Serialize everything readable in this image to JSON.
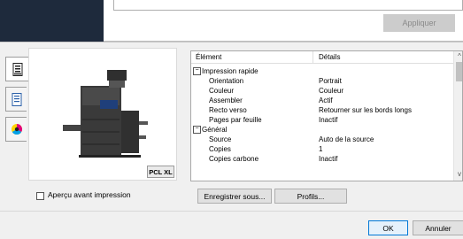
{
  "top": {
    "apply_label": "Appliquer"
  },
  "tabs": [
    {
      "icon": "printer-doc-icon"
    },
    {
      "icon": "document-icon"
    },
    {
      "icon": "color-circle-icon"
    }
  ],
  "preview": {
    "badge": "PCL XL",
    "checkbox_label": "Aperçu avant impression"
  },
  "table": {
    "headers": [
      "Élément",
      "Détails"
    ],
    "groups": [
      {
        "label": "Impression rapide",
        "rows": [
          {
            "name": "Orientation",
            "value": "Portrait"
          },
          {
            "name": "Couleur",
            "value": "Couleur"
          },
          {
            "name": "Assembler",
            "value": "Actif"
          },
          {
            "name": "Recto verso",
            "value": "Retourner sur les bords longs"
          },
          {
            "name": "Pages par feuille",
            "value": "Inactif"
          }
        ]
      },
      {
        "label": "Général",
        "rows": [
          {
            "name": "Source",
            "value": "Auto de la source"
          },
          {
            "name": "Copies",
            "value": "1"
          },
          {
            "name": "Copies carbone",
            "value": "Inactif"
          }
        ]
      }
    ]
  },
  "buttons": {
    "save_as": "Enregistrer sous...",
    "profiles": "Profils...",
    "ok": "OK",
    "cancel": "Annuler"
  }
}
